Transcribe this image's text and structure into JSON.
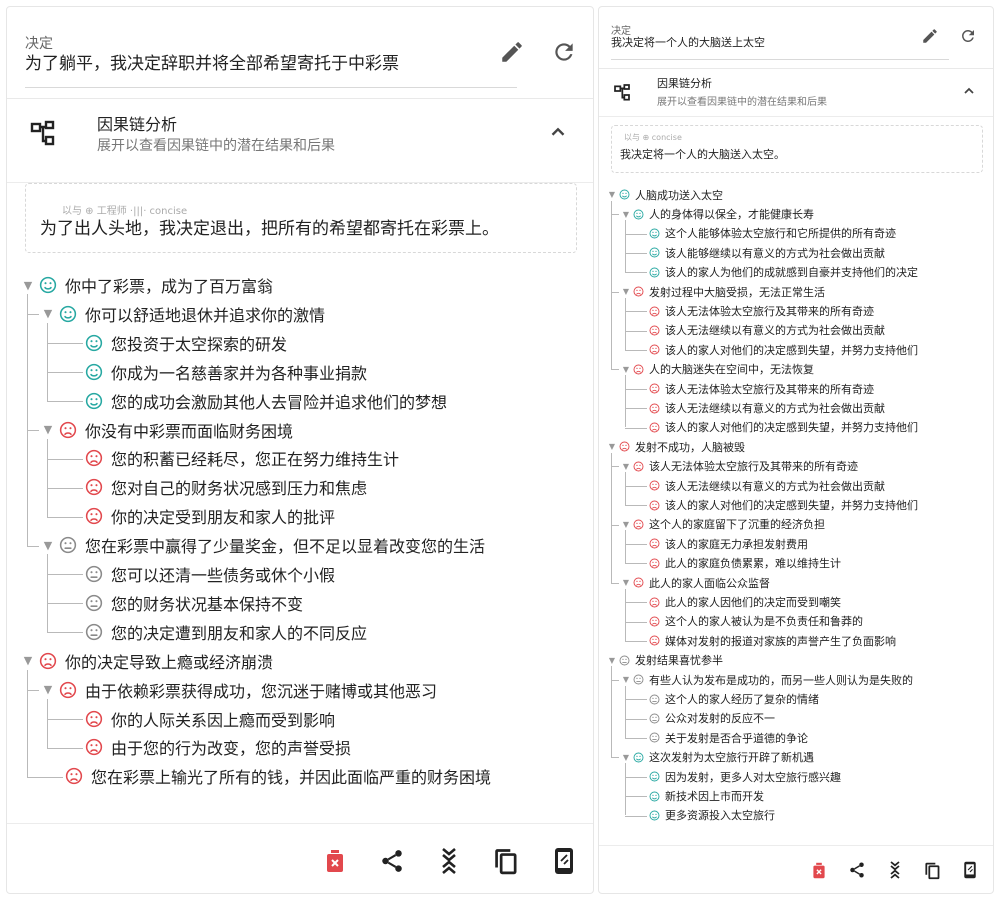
{
  "colors": {
    "positive": "#27a8a2",
    "negative": "#e2484d",
    "neutral": "#8a8a8a",
    "delete": "#e2484d",
    "icon": "#333333"
  },
  "left": {
    "decision_label": "决定",
    "decision_text": "为了躺平，我决定辞职并将全部希望寄托于中彩票",
    "chain_title": "因果链分析",
    "chain_subtitle": "展开以查看因果链中的潜在结果和后果",
    "prompt_watermark": "以与 ⊕ 工程师 ·|||· concise",
    "prompt_text": "为了出人头地，我决定退出，把所有的希望都寄托在彩票上。",
    "tree": [
      {
        "level": 0,
        "caret": "▼",
        "sentiment": "positive",
        "text": "你中了彩票，成为了百万富翁"
      },
      {
        "level": 1,
        "caret": "▼",
        "sentiment": "positive",
        "text": "你可以舒适地退休并追求你的激情"
      },
      {
        "level": 2,
        "caret": "",
        "sentiment": "positive",
        "text": "您投资于太空探索的研发"
      },
      {
        "level": 2,
        "caret": "",
        "sentiment": "positive",
        "text": "你成为一名慈善家并为各种事业捐款"
      },
      {
        "level": 2,
        "caret": "",
        "sentiment": "positive",
        "text": "您的成功会激励其他人去冒险并追求他们的梦想"
      },
      {
        "level": 1,
        "caret": "▼",
        "sentiment": "negative",
        "text": "你没有中彩票而面临财务困境"
      },
      {
        "level": 2,
        "caret": "",
        "sentiment": "negative",
        "text": "您的积蓄已经耗尽，您正在努力维持生计"
      },
      {
        "level": 2,
        "caret": "",
        "sentiment": "negative",
        "text": "您对自己的财务状况感到压力和焦虑"
      },
      {
        "level": 2,
        "caret": "",
        "sentiment": "negative",
        "text": "你的决定受到朋友和家人的批评"
      },
      {
        "level": 1,
        "caret": "▼",
        "sentiment": "neutral",
        "text": "您在彩票中赢得了少量奖金，但不足以显着改变您的生活"
      },
      {
        "level": 2,
        "caret": "",
        "sentiment": "neutral",
        "text": "您可以还清一些债务或休个小假"
      },
      {
        "level": 2,
        "caret": "",
        "sentiment": "neutral",
        "text": "您的财务状况基本保持不变"
      },
      {
        "level": 2,
        "caret": "",
        "sentiment": "neutral",
        "text": "您的决定遭到朋友和家人的不同反应"
      },
      {
        "level": 0,
        "caret": "▼",
        "sentiment": "negative",
        "text": "你的决定导致上瘾或经济崩溃"
      },
      {
        "level": 1,
        "caret": "▼",
        "sentiment": "negative",
        "text": "由于依赖彩票获得成功，您沉迷于赌博或其他恶习"
      },
      {
        "level": 2,
        "caret": "",
        "sentiment": "negative",
        "text": "你的人际关系因上瘾而受到影响"
      },
      {
        "level": 2,
        "caret": "",
        "sentiment": "negative",
        "text": "由于您的行为改变，您的声誉受损"
      },
      {
        "level": 1,
        "caret": "",
        "sentiment": "negative",
        "text": "您在彩票上输光了所有的钱，并因此面临严重的财务困境"
      }
    ]
  },
  "right": {
    "decision_label": "决定",
    "decision_text": "我决定将一个人的大脑送上太空",
    "chain_title": "因果链分析",
    "chain_subtitle": "展开以查看因果链中的潜在结果和后果",
    "prompt_watermark": "以与 ⊕ concise",
    "prompt_text": "我决定将一个人的大脑送入太空。",
    "tree": [
      {
        "level": 0,
        "caret": "▼",
        "sentiment": "positive",
        "text": "人脑成功送入太空"
      },
      {
        "level": 1,
        "caret": "▼",
        "sentiment": "positive",
        "text": "人的身体得以保全，才能健康长寿"
      },
      {
        "level": 2,
        "caret": "",
        "sentiment": "positive",
        "text": "这个人能够体验太空旅行和它所提供的所有奇迹"
      },
      {
        "level": 2,
        "caret": "",
        "sentiment": "positive",
        "text": "该人能够继续以有意义的方式为社会做出贡献"
      },
      {
        "level": 2,
        "caret": "",
        "sentiment": "positive",
        "text": "该人的家人为他们的成就感到自豪并支持他们的决定"
      },
      {
        "level": 1,
        "caret": "▼",
        "sentiment": "negative",
        "text": "发射过程中大脑受损，无法正常生活"
      },
      {
        "level": 2,
        "caret": "",
        "sentiment": "negative",
        "text": "该人无法体验太空旅行及其带来的所有奇迹"
      },
      {
        "level": 2,
        "caret": "",
        "sentiment": "negative",
        "text": "该人无法继续以有意义的方式为社会做出贡献"
      },
      {
        "level": 2,
        "caret": "",
        "sentiment": "negative",
        "text": "该人的家人对他们的决定感到失望，并努力支持他们"
      },
      {
        "level": 1,
        "caret": "▼",
        "sentiment": "negative",
        "text": "人的大脑迷失在空间中，无法恢复"
      },
      {
        "level": 2,
        "caret": "",
        "sentiment": "negative",
        "text": "该人无法体验太空旅行及其带来的所有奇迹"
      },
      {
        "level": 2,
        "caret": "",
        "sentiment": "negative",
        "text": "该人无法继续以有意义的方式为社会做出贡献"
      },
      {
        "level": 2,
        "caret": "",
        "sentiment": "negative",
        "text": "该人的家人对他们的决定感到失望，并努力支持他们"
      },
      {
        "level": 0,
        "caret": "▼",
        "sentiment": "negative",
        "text": "发射不成功，人脑被毁"
      },
      {
        "level": 1,
        "caret": "▼",
        "sentiment": "negative",
        "text": "该人无法体验太空旅行及其带来的所有奇迹"
      },
      {
        "level": 2,
        "caret": "",
        "sentiment": "negative",
        "text": "该人无法继续以有意义的方式为社会做出贡献"
      },
      {
        "level": 2,
        "caret": "",
        "sentiment": "negative",
        "text": "该人的家人对他们的决定感到失望，并努力支持他们"
      },
      {
        "level": 1,
        "caret": "▼",
        "sentiment": "negative",
        "text": "这个人的家庭留下了沉重的经济负担"
      },
      {
        "level": 2,
        "caret": "",
        "sentiment": "negative",
        "text": "该人的家庭无力承担发射费用"
      },
      {
        "level": 2,
        "caret": "",
        "sentiment": "negative",
        "text": "此人的家庭负债累累，难以维持生计"
      },
      {
        "level": 1,
        "caret": "▼",
        "sentiment": "negative",
        "text": "此人的家人面临公众监督"
      },
      {
        "level": 2,
        "caret": "",
        "sentiment": "negative",
        "text": "此人的家人因他们的决定而受到嘲笑"
      },
      {
        "level": 2,
        "caret": "",
        "sentiment": "negative",
        "text": "这个人的家人被认为是不负责任和鲁莽的"
      },
      {
        "level": 2,
        "caret": "",
        "sentiment": "negative",
        "text": "媒体对发射的报道对家族的声誉产生了负面影响"
      },
      {
        "level": 0,
        "caret": "▼",
        "sentiment": "neutral",
        "text": "发射结果喜忧参半"
      },
      {
        "level": 1,
        "caret": "▼",
        "sentiment": "neutral",
        "text": "有些人认为发布是成功的，而另一些人则认为是失败的"
      },
      {
        "level": 2,
        "caret": "",
        "sentiment": "neutral",
        "text": "这个人的家人经历了复杂的情绪"
      },
      {
        "level": 2,
        "caret": "",
        "sentiment": "neutral",
        "text": "公众对发射的反应不一"
      },
      {
        "level": 2,
        "caret": "",
        "sentiment": "neutral",
        "text": "关于发射是否合乎道德的争论"
      },
      {
        "level": 1,
        "caret": "▼",
        "sentiment": "positive",
        "text": "这次发射为太空旅行开辟了新机遇"
      },
      {
        "level": 2,
        "caret": "",
        "sentiment": "positive",
        "text": "因为发射，更多人对太空旅行感兴趣"
      },
      {
        "level": 2,
        "caret": "",
        "sentiment": "positive",
        "text": "新技术因上市而开发"
      },
      {
        "level": 2,
        "caret": "",
        "sentiment": "positive",
        "text": "更多资源投入太空旅行"
      }
    ]
  },
  "icons": {
    "edit": "pencil-icon",
    "refresh": "refresh-icon",
    "chain": "flowchart-icon",
    "collapse": "chevron-up-icon",
    "delete": "trash-icon",
    "share": "share-icon",
    "expand_collapse": "expand-collapse-icon",
    "copy": "copy-icon",
    "mobile": "phone-icon"
  }
}
